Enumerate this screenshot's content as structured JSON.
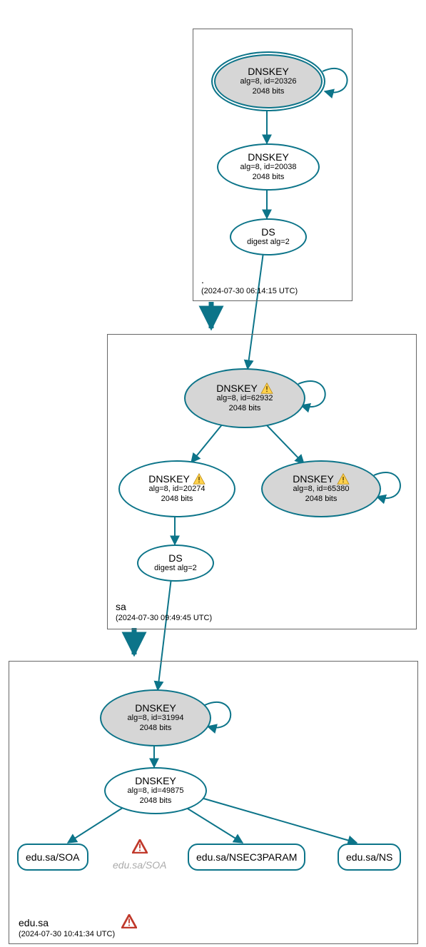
{
  "zones": {
    "root": {
      "name": ".",
      "time": "(2024-07-30 06:14:15 UTC)"
    },
    "sa": {
      "name": "sa",
      "time": "(2024-07-30 09:49:45 UTC)"
    },
    "edu": {
      "name": "edu.sa",
      "time": "(2024-07-30 10:41:34 UTC)"
    }
  },
  "nodes": {
    "root_ksk": {
      "title": "DNSKEY",
      "sub1": "alg=8, id=20326",
      "sub2": "2048 bits"
    },
    "root_zsk": {
      "title": "DNSKEY",
      "sub1": "alg=8, id=20038",
      "sub2": "2048 bits"
    },
    "root_ds": {
      "title": "DS",
      "sub1": "digest alg=2"
    },
    "sa_ksk": {
      "title": "DNSKEY",
      "sub1": "alg=8, id=62932",
      "sub2": "2048 bits"
    },
    "sa_zsk": {
      "title": "DNSKEY",
      "sub1": "alg=8, id=20274",
      "sub2": "2048 bits"
    },
    "sa_zsk2": {
      "title": "DNSKEY",
      "sub1": "alg=8, id=65380",
      "sub2": "2048 bits"
    },
    "sa_ds": {
      "title": "DS",
      "sub1": "digest alg=2"
    },
    "edu_ksk": {
      "title": "DNSKEY",
      "sub1": "alg=8, id=31994",
      "sub2": "2048 bits"
    },
    "edu_zsk": {
      "title": "DNSKEY",
      "sub1": "alg=8, id=49875",
      "sub2": "2048 bits"
    },
    "rr_soa": {
      "label": "edu.sa/SOA"
    },
    "rr_soa_ghost": {
      "label": "edu.sa/SOA"
    },
    "rr_nsec3": {
      "label": "edu.sa/NSEC3PARAM"
    },
    "rr_ns": {
      "label": "edu.sa/NS"
    }
  }
}
